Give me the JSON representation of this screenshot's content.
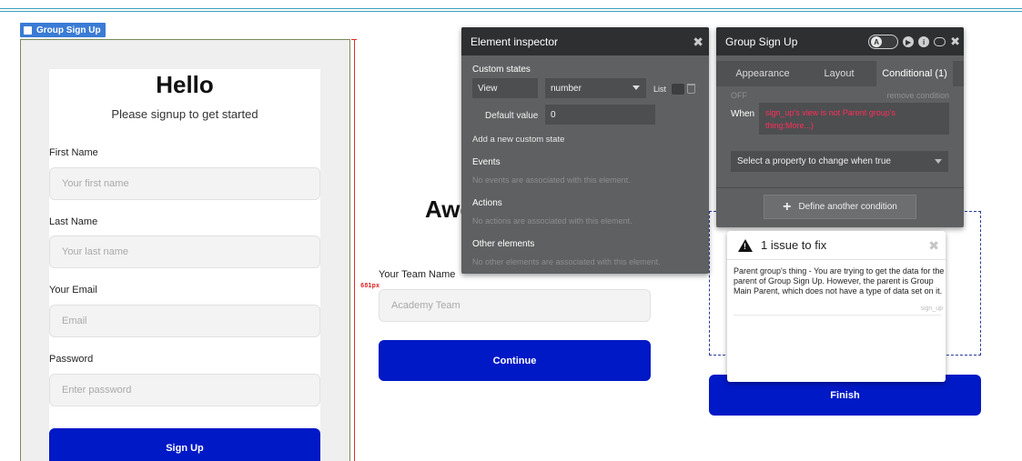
{
  "canvas": {
    "group_tag": "Group Sign Up",
    "px_label": "681px"
  },
  "signup": {
    "title": "Hello",
    "subtitle": "Please signup to get started",
    "fields": [
      {
        "label": "First Name",
        "placeholder": "Your first name"
      },
      {
        "label": "Last Name",
        "placeholder": "Your last name"
      },
      {
        "label": "Your Email",
        "placeholder": "Email"
      },
      {
        "label": "Password",
        "placeholder": "Enter password"
      }
    ],
    "button": "Sign Up"
  },
  "team": {
    "title_partial": "Awe",
    "field_label": "Your Team Name",
    "placeholder": "Academy Team",
    "button": "Continue"
  },
  "finish": {
    "button": "Finish"
  },
  "inspector": {
    "title": "Element inspector",
    "close": "✖",
    "custom_states_heading": "Custom states",
    "state_name": "View",
    "state_type": "number",
    "list_label": "List",
    "default_value_label": "Default value",
    "default_value": "0",
    "add_state": "Add a new custom state",
    "events_heading": "Events",
    "events_empty": "No events are associated with this element.",
    "actions_heading": "Actions",
    "actions_empty": "No actions are associated with this element.",
    "other_heading": "Other elements",
    "other_empty": "No other elements are associated with this element."
  },
  "conditional": {
    "title": "Group Sign Up",
    "toggle_letter": "A",
    "info_letter": "i",
    "tabs": [
      "Appearance",
      "Layout",
      "Conditional (1)"
    ],
    "off_label": "OFF",
    "remove_condition": "remove condition",
    "when_label": "When",
    "when_expression": "sign_up's view is not Parent group's thing:More...)",
    "property_select": "Select a property to change when true",
    "define_button": "Define another condition",
    "close": "✖"
  },
  "issue": {
    "title": "1 issue to fix",
    "message": "Parent group's thing - You are trying to get the data for the parent of Group Sign Up. However, the parent is Group Main Parent, which does not have a type of data set on it.",
    "element_tag": "sign_up",
    "close": "✖"
  },
  "colors": {
    "primary_button": "#0019c6",
    "panel_bg": "#5f6061",
    "panel_header": "#2d2f31",
    "condition_text": "#ff2e5b",
    "tag_blue": "#3a7bd5"
  }
}
